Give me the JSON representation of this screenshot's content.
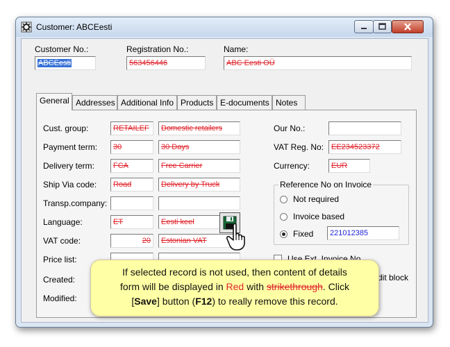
{
  "window": {
    "title": "Customer: ABCEesti"
  },
  "header": {
    "customer_no_label": "Customer No.:",
    "customer_no_value": "ABCEesti",
    "registration_no_label": "Registration No.:",
    "registration_no_value": "563456446",
    "name_label": "Name:",
    "name_value": "ABC Eesti OÜ"
  },
  "tabs": [
    "General",
    "Addresses",
    "Additional Info",
    "Products",
    "E-documents",
    "Notes"
  ],
  "general": {
    "cust_group_label": "Cust. group:",
    "cust_group_code": "RETAILEF",
    "cust_group_desc": "Domestic retailers",
    "payment_term_label": "Payment term:",
    "payment_term_code": "30",
    "payment_term_desc": "30 Days",
    "delivery_term_label": "Delivery term:",
    "delivery_term_code": "FCA",
    "delivery_term_desc": "Free Carrier",
    "ship_via_label": "Ship Via code:",
    "ship_via_code": "Road",
    "ship_via_desc": "Delivery by Truck",
    "transp_company_label": "Transp.company:",
    "language_label": "Language:",
    "language_code": "ET",
    "language_desc": "Eesti keel",
    "vat_code_label": "VAT code:",
    "vat_code_code": "20",
    "vat_code_desc": "Estonian VAT",
    "price_list_label": "Price list:",
    "created_label": "Created:",
    "modified_label": "Modified:",
    "our_no_label": "Our No.:",
    "vat_reg_label": "VAT Reg. No:",
    "vat_reg_value": "EE234523372",
    "currency_label": "Currency:",
    "currency_value": "EUR",
    "ref_group_title": "Reference No on Invoice",
    "ref_options": [
      "Not required",
      "Invoice based",
      "Fixed"
    ],
    "ref_selected": "Fixed",
    "ref_fixed_value": "221012385",
    "use_ext_invoice_label": "Use Ext. Invoice No",
    "credit_block_label": "dit block"
  },
  "tooltip": {
    "line1": "If selected record is not used, then content of details",
    "line2_a": "form will be displayed in ",
    "line2_red": "Red",
    "line2_b": " with ",
    "line2_strike": "strikethrough",
    "line2_c": ".  Click",
    "line3_a": "[",
    "line3_save": "Save",
    "line3_b": "] button (",
    "line3_key": "F12",
    "line3_c": ") to really remove this record."
  },
  "icons": {
    "app": "customer-app-icon",
    "save": "floppy-disk-icon",
    "cursor": "hand-pointer-icon"
  },
  "colors": {
    "unused_record_text": "#e0262e",
    "value_text": "#1f25d6",
    "tooltip_bg": "#ffffa5"
  }
}
